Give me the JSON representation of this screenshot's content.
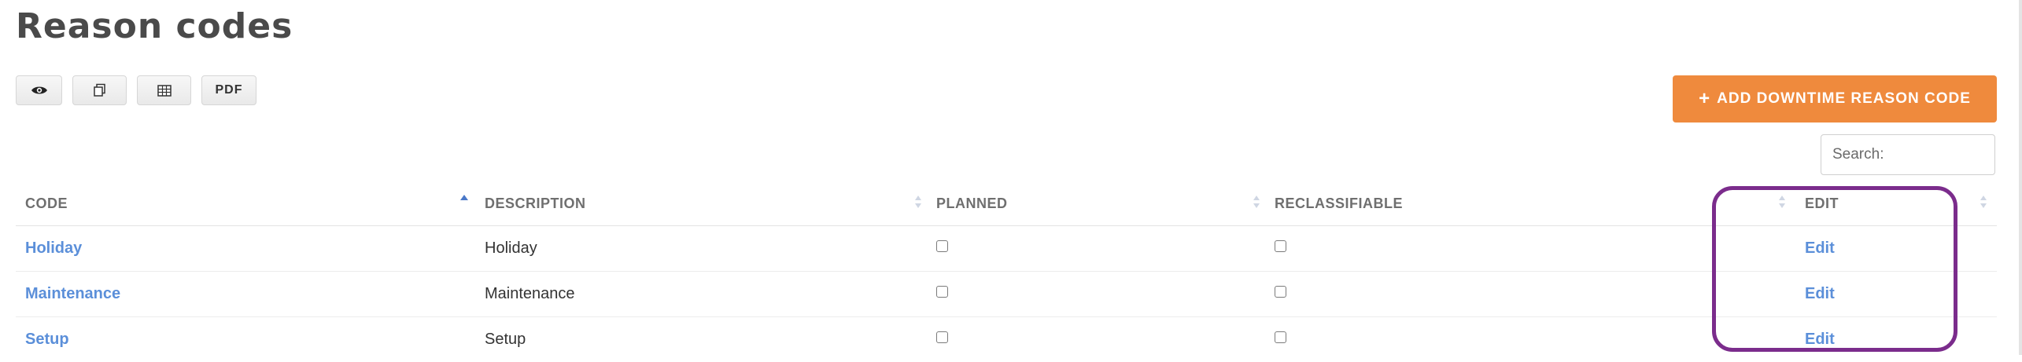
{
  "page": {
    "title": "Reason codes"
  },
  "export_buttons": [
    {
      "name": "view-button",
      "icon": "eye-icon"
    },
    {
      "name": "copy-button",
      "icon": "copy-icon"
    },
    {
      "name": "excel-button",
      "icon": "table-icon"
    },
    {
      "name": "pdf-button",
      "label": "PDF"
    }
  ],
  "actions": {
    "add_label": "ADD DOWNTIME REASON CODE",
    "add_icon": "+"
  },
  "search": {
    "placeholder": "Search:"
  },
  "table": {
    "columns": [
      "CODE",
      "DESCRIPTION",
      "PLANNED",
      "RECLASSIFIABLE",
      "EDIT"
    ],
    "sort": {
      "column": "CODE",
      "direction": "ascending"
    },
    "rows": [
      {
        "code": "Holiday",
        "description": "Holiday",
        "planned": false,
        "reclassifiable": false,
        "edit": "Edit"
      },
      {
        "code": "Maintenance",
        "description": "Maintenance",
        "planned": false,
        "reclassifiable": false,
        "edit": "Edit"
      },
      {
        "code": "Setup",
        "description": "Setup",
        "planned": false,
        "reclassifiable": false,
        "edit": "Edit"
      }
    ]
  },
  "colors": {
    "accent": "#ef8a3d",
    "link": "#5b8fd9",
    "highlight": "#7b2c8c"
  }
}
